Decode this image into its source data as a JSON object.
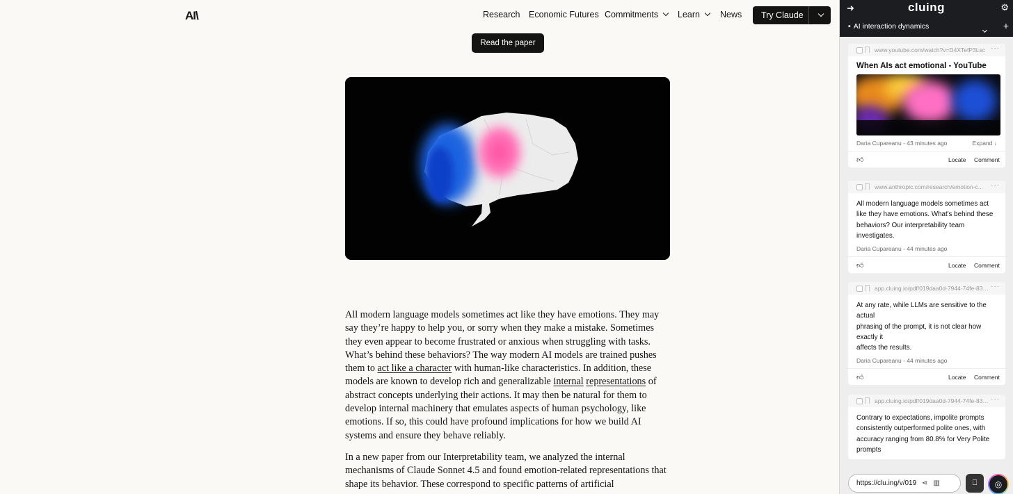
{
  "nav": {
    "logo": "AI\\",
    "items": [
      "Research",
      "Economic Futures",
      "Commitments",
      "Learn",
      "News"
    ],
    "cta": "Try Claude"
  },
  "read_paper": "Read the paper",
  "article": {
    "p1_a": "All modern language models sometimes act like they have emotions. They may say they’re happy to help you, or sorry when they make a mistake. Sometimes they even appear to become frustrated or anxious when struggling with tasks. What’s behind these behaviors? The way modern AI models are trained pushes them to ",
    "link1": "act like a character",
    "p1_b": " with human-like characteristics. In addition, these models are known to develop rich and generalizable ",
    "link2": "internal",
    "link3": "representations",
    "p1_c": " of abstract concepts underlying their actions. It may then be natural for them to develop internal machinery that emulates aspects of human psychology, like emotions. If so, this could have profound implications for how we build AI systems and ensure they behave reliably.",
    "p2": "In a new paper from our Interpretability team, we analyzed the internal mechanisms of Claude Sonnet 4.5 and found emotion-related representations that shape its behavior. These correspond to specific patterns of artificial"
  },
  "panel": {
    "brand": "cluing",
    "collection": "AI interaction dynamics",
    "cards": [
      {
        "url": "www.youtube.com/watch?v=D4XTefP3Lsc",
        "title": "When AIs act emotional - YouTube",
        "text": "",
        "author": "Daria Cupareanu - 43 minutes ago",
        "expand": "Expand ↓"
      },
      {
        "url": "www.anthropic.com/research/emotion-c...",
        "title": "",
        "text": "All modern language models sometimes act like they have emotions. What's behind these behaviors? Our interpretability team investigates.",
        "author": "Daria Cupareanu - 44 minutes ago",
        "expand": ""
      },
      {
        "url": "app.cluing.io/pdf/019daa0d-7944-74fe-83be...",
        "title": "",
        "text": "At any rate, while LLMs are sensitive to the actual\nphrasing of the prompt, it is not clear how exactly it\naffects the results.",
        "author": "Daria Cupareanu - 44 minutes ago",
        "expand": ""
      },
      {
        "url": "app.cluing.io/pdf/019daa0d-7944-74fe-83be...",
        "title": "",
        "text": "Contrary to expectations, impolite prompts consistently outperformed polite ones, with\naccuracy ranging from 80.8% for Very Polite prompts",
        "author": "",
        "expand": ""
      }
    ],
    "locate": "Locate",
    "comment": "Comment",
    "bottom_url": "https://clu.ing/v/019"
  }
}
